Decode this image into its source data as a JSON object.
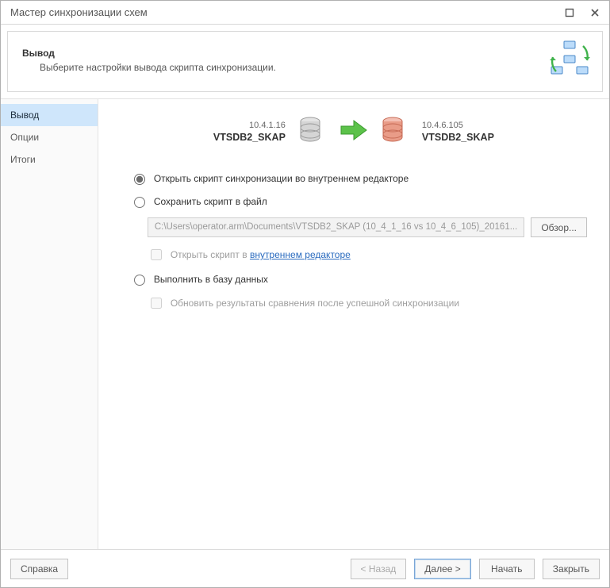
{
  "window": {
    "title": "Мастер синхронизации схем"
  },
  "header": {
    "title": "Вывод",
    "subtitle": "Выберите настройки вывода скрипта синхронизации."
  },
  "sidebar": {
    "items": [
      {
        "label": "Вывод",
        "selected": true
      },
      {
        "label": "Опции",
        "selected": false
      },
      {
        "label": "Итоги",
        "selected": false
      }
    ]
  },
  "databases": {
    "source": {
      "ip": "10.4.1.16",
      "name": "VTSDB2_SKAP"
    },
    "target": {
      "ip": "10.4.6.105",
      "name": "VTSDB2_SKAP"
    }
  },
  "options": {
    "open_in_internal_editor": "Открыть скрипт синхронизации во внутреннем редакторе",
    "save_to_file": "Сохранить скрипт в файл",
    "file_path": "C:\\Users\\operator.arm\\Documents\\VTSDB2_SKAP (10_4_1_16 vs 10_4_6_105)_20161...",
    "browse": "Обзор...",
    "open_script_prefix": "Открыть скрипт в ",
    "open_script_link": "внутреннем редакторе",
    "execute_to_db": "Выполнить в базу данных",
    "update_results": "Обновить результаты сравнения после успешной синхронизации"
  },
  "footer": {
    "help": "Справка",
    "back": "< Назад",
    "next": "Далее >",
    "start": "Начать",
    "close": "Закрыть"
  }
}
